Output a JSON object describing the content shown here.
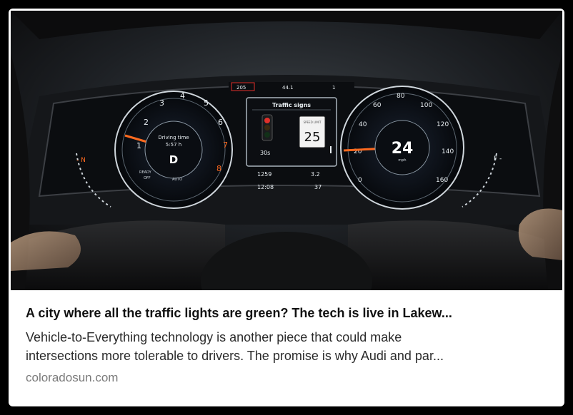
{
  "card": {
    "title": "A city where all the traffic lights are green? The tech is live in Lakew...",
    "description_line1": "Vehicle-to-Everything technology is another piece that could make",
    "description_line2": "intersections more tolerable to drivers. The promise is why Audi and par...",
    "domain": "coloradosun.com"
  },
  "dashboard": {
    "top_left_readout": "205",
    "top_center_readout": "44.1",
    "top_right_readout": "1",
    "left_gauge_label1": "Driving time",
    "left_gauge_label2": "5:57 h",
    "gear": "D",
    "left_gauge_ready": "READY",
    "left_gauge_off": "OFF",
    "left_gauge_auto": "AUTO",
    "panel_title": "Traffic signs",
    "light_timer": "30s",
    "speed_sign_label": "SPEED LIMIT",
    "speed_limit": "25",
    "odometer": "1259",
    "trip": "3.2",
    "clock": "12:08",
    "temperature": "37",
    "speed": "24",
    "speed_unit": "mph",
    "tach_ticks": [
      "1",
      "2",
      "3",
      "4",
      "5",
      "6",
      "7",
      "8"
    ],
    "speedo_ticks": [
      "0",
      "20",
      "40",
      "60",
      "80",
      "100",
      "120",
      "140",
      "160"
    ],
    "colors": {
      "needle": "#ff6a1f",
      "dial_text": "#e8eef2",
      "panel_bg": "#0c0e12",
      "light_red": "#e0302a"
    }
  }
}
